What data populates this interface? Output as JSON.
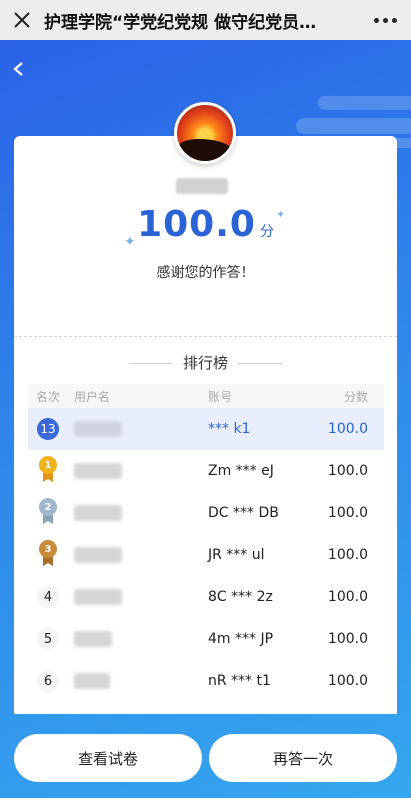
{
  "topbar": {
    "title": "护理学院“学党纪党规 做守纪党员…",
    "close_icon": "close-icon",
    "more_icon": "more-icon"
  },
  "result": {
    "score": "100.0",
    "unit": "分",
    "message": "感谢您的作答！"
  },
  "leaderboard": {
    "title": "排行榜",
    "headers": [
      "名次",
      "用户名",
      "账号",
      "分数"
    ],
    "rows": [
      {
        "rank": "13",
        "account": "*** k1",
        "score": "100.0",
        "me": true
      },
      {
        "rank": "1",
        "account": "Zm *** eJ",
        "score": "100.0",
        "medal": "gold"
      },
      {
        "rank": "2",
        "account": "DC *** DB",
        "score": "100.0",
        "medal": "silver"
      },
      {
        "rank": "3",
        "account": "JR *** ul",
        "score": "100.0",
        "medal": "bronze"
      },
      {
        "rank": "4",
        "account": "8C *** 2z",
        "score": "100.0"
      },
      {
        "rank": "5",
        "account": "4m *** JP",
        "score": "100.0"
      },
      {
        "rank": "6",
        "account": "nR *** t1",
        "score": "100.0"
      }
    ]
  },
  "actions": {
    "view_paper": "查看试卷",
    "retry": "再答一次"
  },
  "colors": {
    "accent": "#2a63d6",
    "gold": "#f2b21c",
    "silver": "#9fb6cc",
    "bronze": "#c98a3a"
  }
}
